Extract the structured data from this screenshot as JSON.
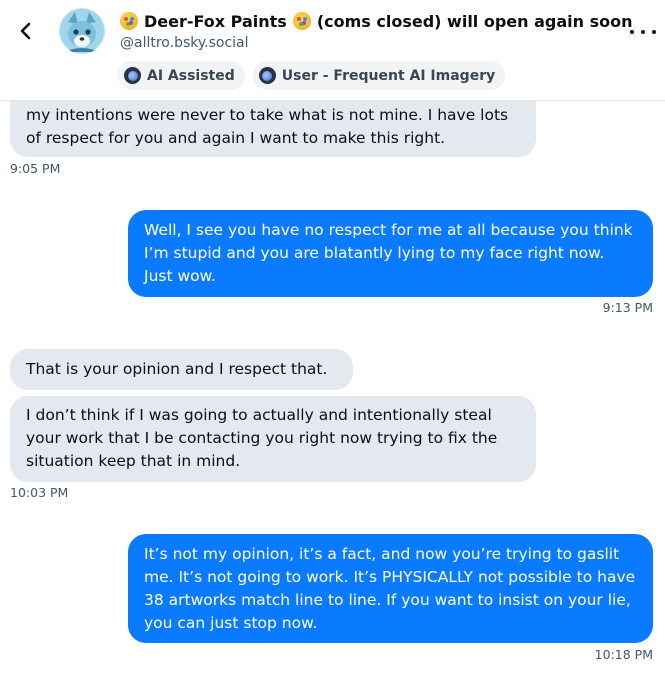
{
  "header": {
    "display_name": "Deer-Fox Paints",
    "display_name_suffix": "(coms closed) will open again soon",
    "handle": "@alltro.bsky.social",
    "badges": [
      "AI Assisted",
      "User - Frequent AI Imagery"
    ]
  },
  "messages": [
    {
      "side": "in",
      "text": "my intentions were never to take what is not mine. I have lots of respect for you and again I want to make this right.",
      "time": "9:05 PM"
    },
    {
      "side": "out",
      "text": "Well, I see you have no respect for me at all because you think I’m stupid and you are blatantly lying to my face right now. Just wow.",
      "time": "9:13 PM"
    },
    {
      "side": "in",
      "text": "That is your opinion and I respect that."
    },
    {
      "side": "in",
      "text": "I don’t think if I was going to actually and intentionally steal your work that I be contacting you right now trying to fix the situation keep that in mind.",
      "time": "10:03 PM"
    },
    {
      "side": "out",
      "text": "It’s not my opinion, it’s a fact, and now you’re trying to gaslit me. It’s not going to work. It’s PHYSICALLY not possible to have 38 artworks match line to line. If you want to insist on your lie, you can just stop now.",
      "time": "10:18 PM"
    }
  ]
}
